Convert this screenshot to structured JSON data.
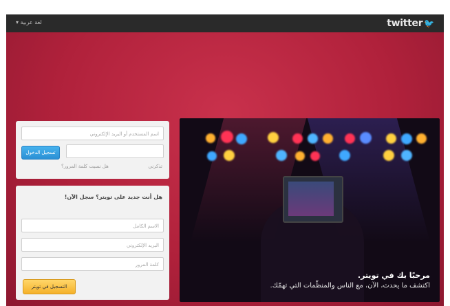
{
  "topbar": {
    "language_label": "لغة عربية ▾",
    "logo_text": "twitter"
  },
  "hero": {
    "title": "مرحبًا بك في تويتر.",
    "subtitle": "اكتشف ما يحدث، الآن، مع الناس والمنظّمات التي تهمّك."
  },
  "signin": {
    "username_placeholder": "اسم المستخدم أو البريد الإلكتروني",
    "password_placeholder": "",
    "submit_label": "تسجيل الدخول",
    "remember_label": "تذكرني",
    "forgot_label": "هل نسيت كلمة المرور؟"
  },
  "signup": {
    "title": "هل أنت جديد على تويتر؟ سجل الآن!",
    "name_placeholder": "الاسم الكامل",
    "email_placeholder": "البريد الإلكتروني",
    "password_placeholder": "كلمة المرور",
    "submit_label": "التسجيل في تويتر"
  },
  "colors": {
    "background_red": "#b0213b",
    "topbar": "#2a2a2a",
    "signin_button": "#2a8fd4",
    "signup_button": "#f5b12a"
  }
}
